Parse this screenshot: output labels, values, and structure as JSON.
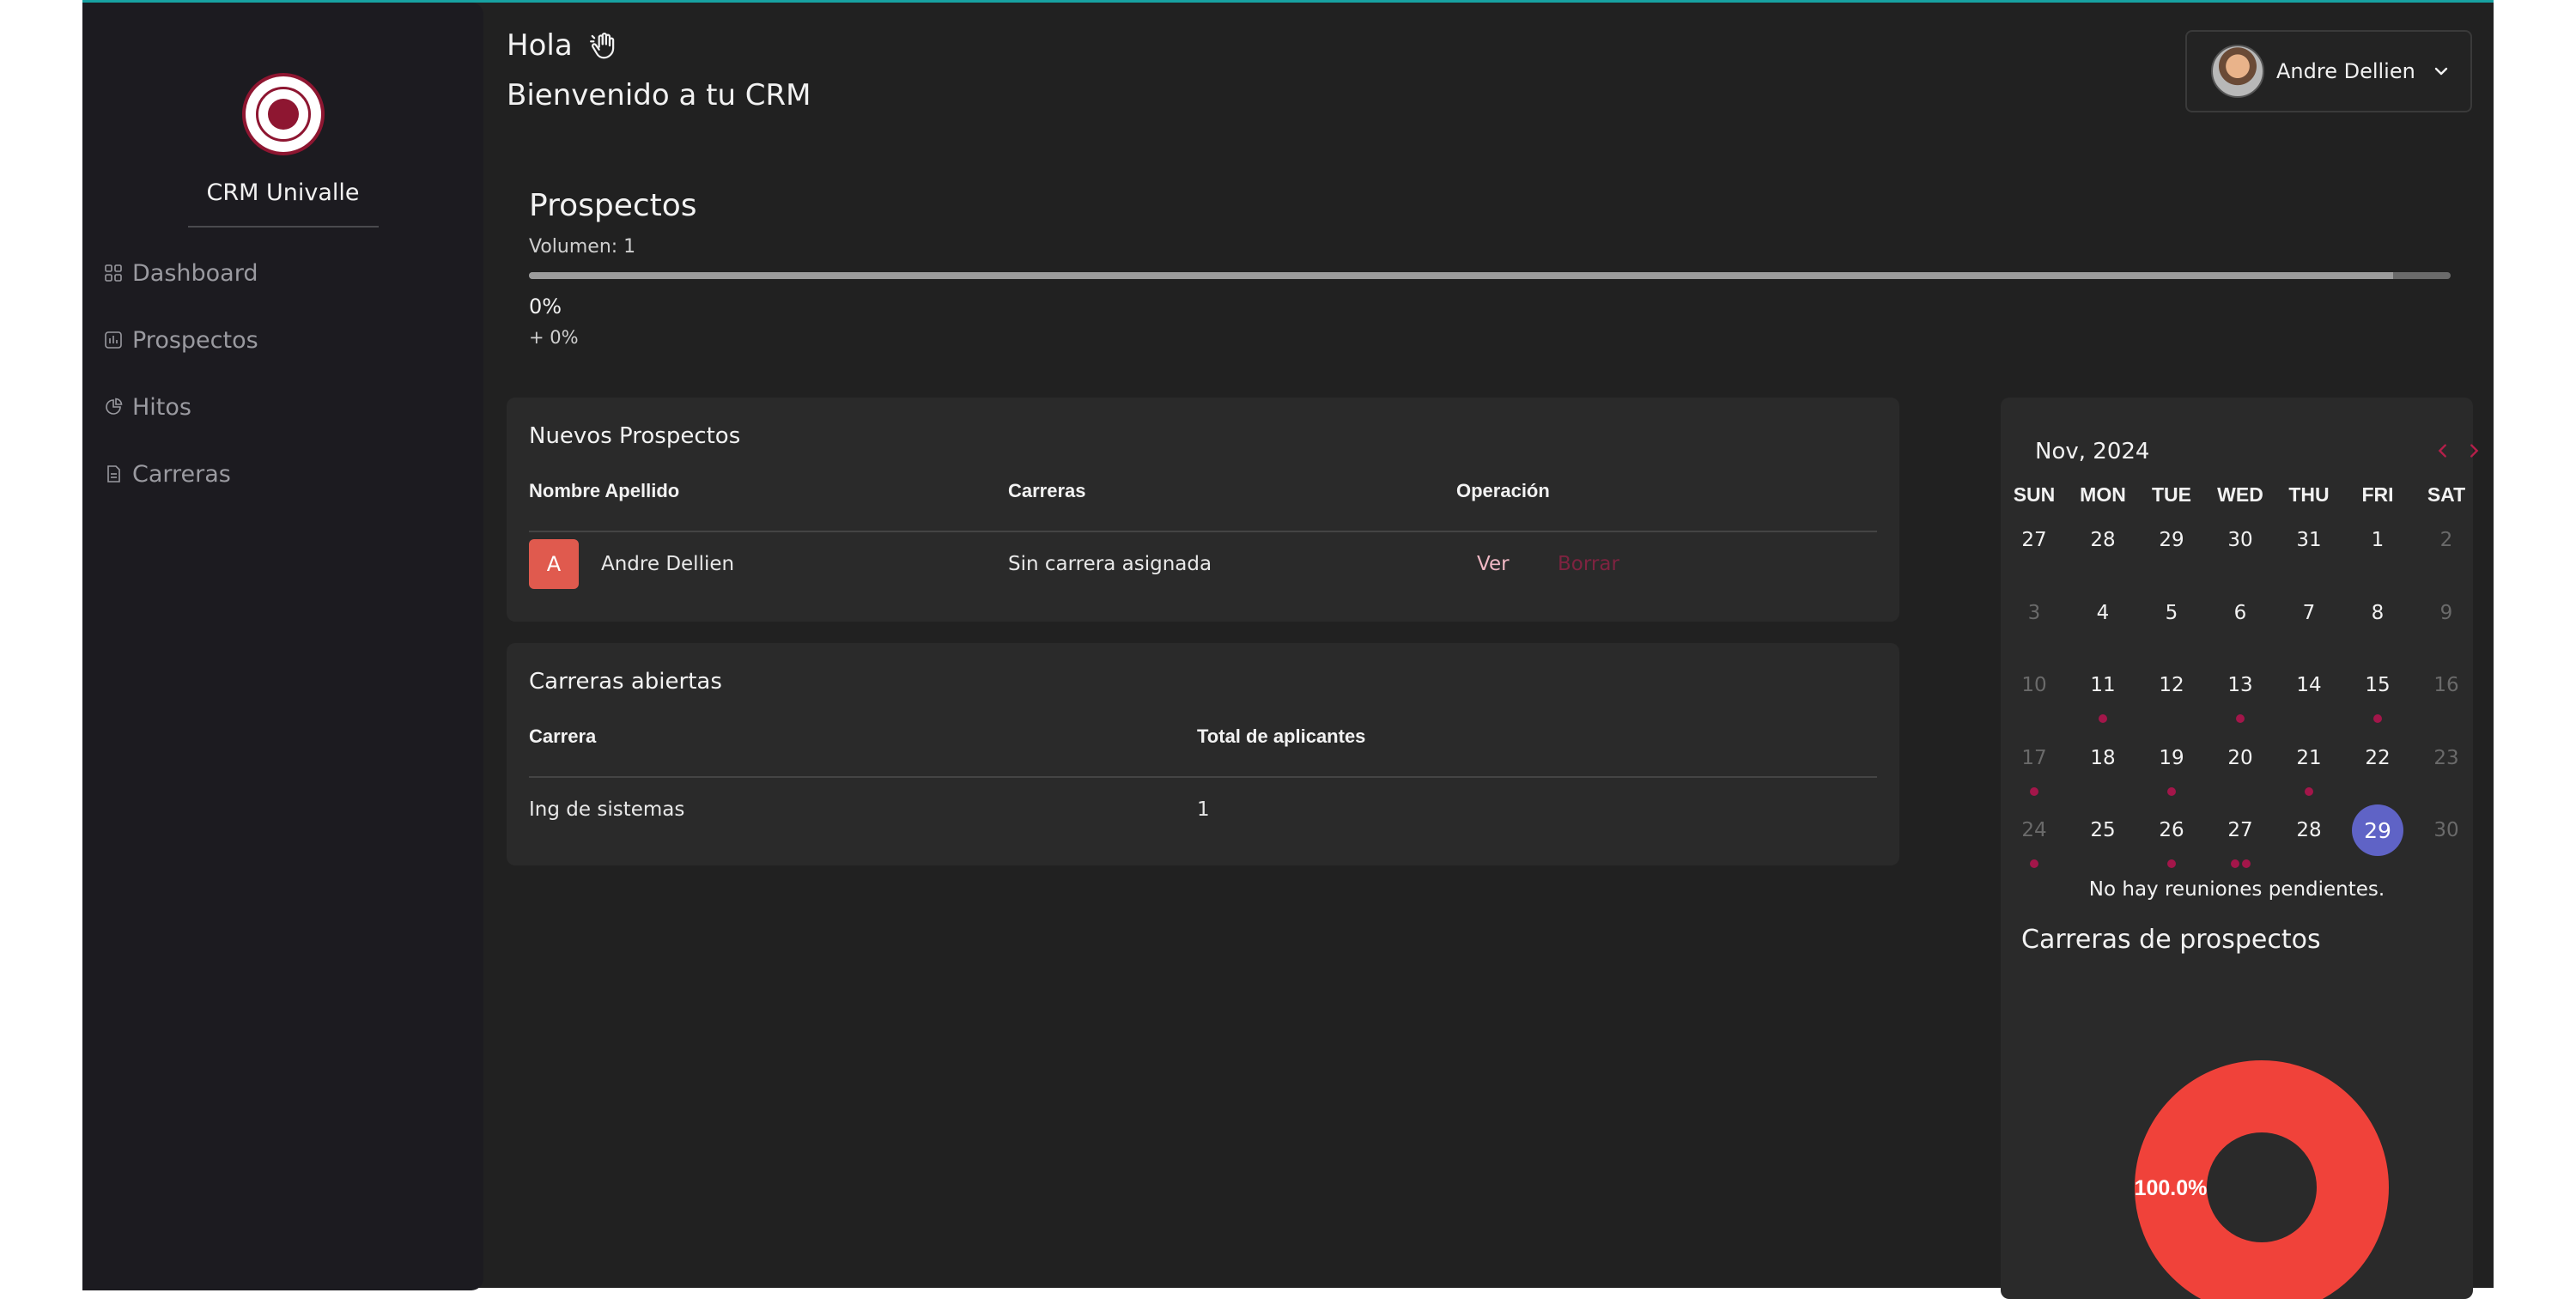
{
  "sidebar": {
    "brand": "CRM Univalle",
    "items": [
      {
        "label": "Dashboard",
        "icon": "dashboard-icon"
      },
      {
        "label": "Prospectos",
        "icon": "chart-bars-icon"
      },
      {
        "label": "Hitos",
        "icon": "pie-icon"
      },
      {
        "label": "Carreras",
        "icon": "document-icon"
      }
    ]
  },
  "header": {
    "greeting": "Hola",
    "welcome": "Bienvenido a tu CRM",
    "wave_icon": "waving-hand-icon",
    "user_name": "Andre Dellien"
  },
  "prospectos": {
    "title": "Prospectos",
    "volume": "Volumen: 1",
    "percent": "0%",
    "delta": "+ 0%",
    "progress": 0.97
  },
  "nuevos": {
    "title": "Nuevos Prospectos",
    "headers": [
      "Nombre Apellido",
      "Carreras",
      "Operación"
    ],
    "rows": [
      {
        "initial": "A",
        "name": "Andre Dellien",
        "career": "Sin carrera asignada",
        "view": "Ver",
        "delete": "Borrar"
      }
    ]
  },
  "carreras": {
    "title": "Carreras abiertas",
    "headers": [
      "Carrera",
      "Total de aplicantes"
    ],
    "rows": [
      {
        "career": "Ing de sistemas",
        "total": "1"
      }
    ]
  },
  "calendar": {
    "title": "Nov, 2024",
    "prev": "‹",
    "next": "›",
    "days_of_week": [
      "SUN",
      "MON",
      "TUE",
      "WED",
      "THU",
      "FRI",
      "SAT"
    ],
    "weeks": [
      [
        {
          "d": "27",
          "m": false
        },
        {
          "d": "28",
          "m": false
        },
        {
          "d": "29",
          "m": false
        },
        {
          "d": "30",
          "m": false
        },
        {
          "d": "31",
          "m": false
        },
        {
          "d": "1",
          "m": false
        },
        {
          "d": "2",
          "m": true
        }
      ],
      [
        {
          "d": "3",
          "m": true
        },
        {
          "d": "4",
          "m": false
        },
        {
          "d": "5",
          "m": false
        },
        {
          "d": "6",
          "m": false
        },
        {
          "d": "7",
          "m": false
        },
        {
          "d": "8",
          "m": false
        },
        {
          "d": "9",
          "m": true
        }
      ],
      [
        {
          "d": "10",
          "m": true
        },
        {
          "d": "11",
          "m": false,
          "dots": 1
        },
        {
          "d": "12",
          "m": false
        },
        {
          "d": "13",
          "m": false,
          "dots": 1
        },
        {
          "d": "14",
          "m": false
        },
        {
          "d": "15",
          "m": false,
          "dots": 1
        },
        {
          "d": "16",
          "m": true
        }
      ],
      [
        {
          "d": "17",
          "m": true,
          "dots": 1
        },
        {
          "d": "18",
          "m": false
        },
        {
          "d": "19",
          "m": false,
          "dots": 1
        },
        {
          "d": "20",
          "m": false
        },
        {
          "d": "21",
          "m": false,
          "dots": 1
        },
        {
          "d": "22",
          "m": false
        },
        {
          "d": "23",
          "m": true
        }
      ],
      [
        {
          "d": "24",
          "m": true,
          "dots": 1
        },
        {
          "d": "25",
          "m": false
        },
        {
          "d": "26",
          "m": false,
          "dots": 1
        },
        {
          "d": "27",
          "m": false,
          "dots": 2
        },
        {
          "d": "28",
          "m": false
        },
        {
          "d": "29",
          "m": false,
          "today": true
        },
        {
          "d": "30",
          "m": true
        }
      ]
    ],
    "no_meetings": "No hay reuniones pendientes."
  },
  "colors": {
    "accent_red": "#a3164a",
    "today": "#5f63c6",
    "donut": "#f0423a"
  },
  "chart_data": {
    "type": "pie",
    "title": "Carreras de prospectos",
    "slices": [
      {
        "label": "100.0%",
        "value": 100
      }
    ]
  }
}
